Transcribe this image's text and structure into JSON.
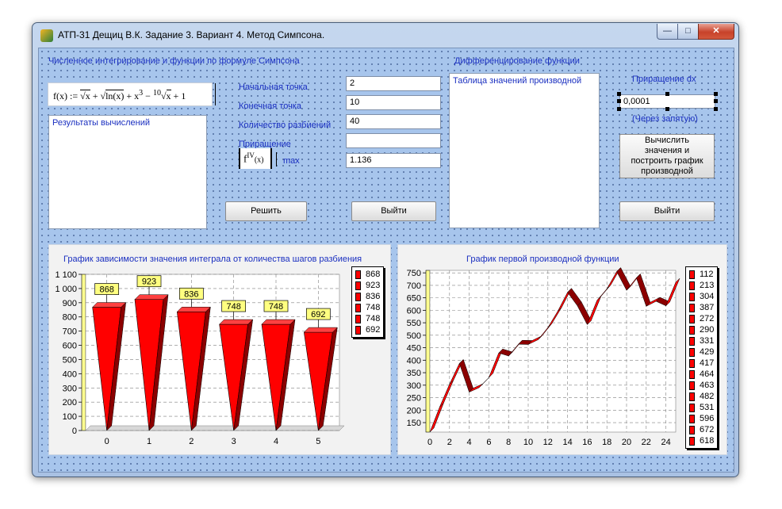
{
  "window": {
    "title": "АТП-31 Дещиц В.К. Задание 3. Вариант 4. Метод Симпсона.",
    "min_glyph": "—",
    "max_glyph": "□",
    "close_glyph": "✕"
  },
  "integration": {
    "heading": "Численное интегрирование и функции по формуле Симпсона",
    "formula": {
      "lhs": "f(x) := ",
      "t1": "x",
      "plus": " + ",
      "t2": "ln(x)",
      "t3": "x",
      "exp3": "3",
      "minus": " − ",
      "root10": "10",
      "t4": "x",
      "tail": " + 1"
    },
    "results_label": "Результаты вычислений",
    "start_label": "Начальная точка",
    "start_value": "2",
    "end_label": "Конечная точка",
    "end_value": "10",
    "count_label": "Количество разбиений",
    "count_value": "40",
    "step_label": "Приращение",
    "step_value": "",
    "fiv": {
      "f": "f",
      "sup": "IV",
      "arg": "(x)"
    },
    "max_label": "max",
    "max_value": "1.136",
    "solve_button": "Решить",
    "exit_button": "Выйти"
  },
  "differentiation": {
    "heading": "Дифференцирование функции",
    "table_label": "Таблица значений производной",
    "dx_label": "Приращение dx",
    "dx_value": "0,0001",
    "dx_hint": "(Через запятую)",
    "compute_button": "Вычислить значения и построить график производной",
    "exit_button": "Выйти"
  },
  "colors": {
    "accent": "#1a2fc0",
    "bar": "#ff0000",
    "bar_dark": "#8b0000",
    "label_fill": "#ffff80"
  },
  "chart_data": [
    {
      "type": "bar",
      "title": "График зависимости значения интеграла от количества шагов разбиения",
      "categories": [
        "0",
        "1",
        "2",
        "3",
        "4",
        "5"
      ],
      "values": [
        868,
        923,
        836,
        748,
        748,
        692
      ],
      "ylim": [
        0,
        1100
      ],
      "yticks": [
        0,
        100,
        200,
        300,
        400,
        500,
        600,
        700,
        800,
        900,
        1000,
        1100
      ],
      "ytick_labels": [
        "0",
        "100",
        "200",
        "300",
        "400",
        "500",
        "600",
        "700",
        "800",
        "900",
        "1 000",
        "1 100"
      ],
      "legend": [
        "868",
        "923",
        "836",
        "748",
        "748",
        "692"
      ],
      "legend_placement": "right",
      "grid": true
    },
    {
      "type": "line",
      "title": "График первой производной функции",
      "x": [
        0,
        1,
        2,
        3,
        4,
        5,
        6,
        7,
        8,
        9,
        10,
        11,
        12,
        13,
        14,
        15,
        16,
        17,
        18,
        19,
        20,
        21,
        22,
        23,
        24,
        25
      ],
      "y": [
        112,
        213,
        304,
        387,
        272,
        290,
        331,
        429,
        417,
        464,
        463,
        482,
        531,
        596,
        672,
        618,
        543,
        640,
        686,
        755,
        680,
        730,
        616,
        636,
        618,
        712
      ],
      "xlim": [
        0,
        25
      ],
      "ylim": [
        112,
        760
      ],
      "xticks": [
        0,
        2,
        4,
        6,
        8,
        10,
        12,
        14,
        16,
        18,
        20,
        22,
        24
      ],
      "yticks": [
        150,
        200,
        250,
        300,
        350,
        400,
        450,
        500,
        550,
        600,
        650,
        700,
        750
      ],
      "legend": [
        "112",
        "213",
        "304",
        "387",
        "272",
        "290",
        "331",
        "429",
        "417",
        "464",
        "463",
        "482",
        "531",
        "596",
        "672",
        "618"
      ],
      "legend_placement": "right",
      "grid": true
    }
  ]
}
